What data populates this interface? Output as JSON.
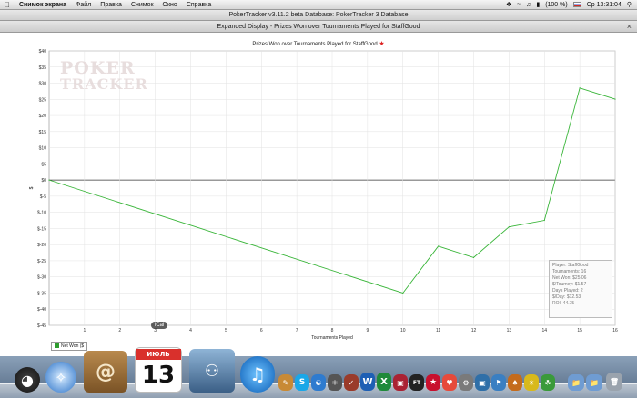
{
  "menubar": {
    "app": "Снимок экрана",
    "items": [
      "Файл",
      "Правка",
      "Снимок",
      "Окно",
      "Справка"
    ],
    "battery": "(100 %)",
    "clock": "Ср 13:31:04"
  },
  "window": {
    "title": "PokerTracker v3.11.2 beta   Database: PokerTracker 3 Database",
    "subtitle": "Expanded Display - Prizes Won over Tournaments Played for StaffGood"
  },
  "logo": {
    "line1": "POKER",
    "line2": "TRACKER"
  },
  "chart_data": {
    "type": "line",
    "title": "Prizes Won over Tournaments Played for StaffGood",
    "xlabel": "Tournaments Played",
    "ylabel": "$",
    "x": [
      0,
      10,
      11,
      12,
      13,
      14,
      15,
      16
    ],
    "series": [
      {
        "name": "Net Won ($)",
        "values": [
          0,
          -35,
          -20.5,
          -24,
          -14.5,
          -12.5,
          28.5,
          25.06
        ]
      }
    ],
    "xticks": [
      1,
      2,
      3,
      4,
      5,
      6,
      7,
      8,
      9,
      10,
      11,
      12,
      13,
      14,
      15,
      16
    ],
    "yticks": [
      40,
      35,
      30,
      25,
      20,
      15,
      10,
      5,
      0,
      -5,
      -10,
      -15,
      -20,
      -25,
      -30,
      -35,
      -40,
      -45
    ],
    "ytick_labels": [
      "$40",
      "$35",
      "$30",
      "$25",
      "$20",
      "$15",
      "$10",
      "$5",
      "$0",
      "$-5",
      "$-10",
      "$-15",
      "$-20",
      "$-25",
      "$-30",
      "$-35",
      "$-40",
      "$-45"
    ],
    "xlim": [
      0,
      16
    ],
    "ylim": [
      -45,
      40
    ],
    "grid": true,
    "legend": "bottom-left",
    "color": "#39b539"
  },
  "legend": {
    "label": "Net Won ($"
  },
  "stats": {
    "player": "Player: StaffGood",
    "tournaments": "Tournaments: 16",
    "net_won": "Net Won: $25.06",
    "per_tourney": "$/Tourney: $1.57",
    "days_played": "Days Played: 2",
    "per_day": "$/Day: $12.53",
    "roi": "ROI: 44.75"
  },
  "dock": {
    "ical_tooltip": "iCal",
    "calendar_month": "ИЮЛЬ",
    "calendar_day": "13"
  }
}
